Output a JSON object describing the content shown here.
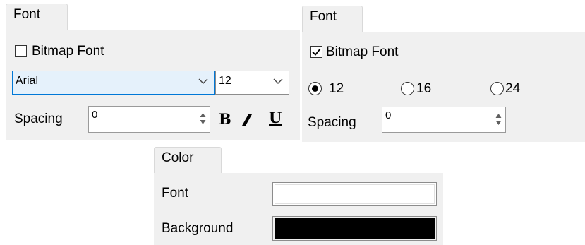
{
  "left_panel": {
    "tab_label": "Font",
    "bitmap_checkbox": {
      "label": "Bitmap Font",
      "checked": false
    },
    "font_name": "Arial",
    "font_size": "12",
    "spacing_label": "Spacing",
    "spacing_value": "0",
    "bold_label": "B",
    "italic_label": "I",
    "underline_label": "U"
  },
  "right_panel": {
    "tab_label": "Font",
    "bitmap_checkbox": {
      "label": "Bitmap Font",
      "checked": true
    },
    "size_options": [
      "12",
      "16",
      "24"
    ],
    "selected_size": "12",
    "spacing_label": "Spacing",
    "spacing_value": "0"
  },
  "color_panel": {
    "tab_label": "Color",
    "font_label": "Font",
    "background_label": "Background",
    "font_color": "#ffffff",
    "background_color": "#000000"
  }
}
